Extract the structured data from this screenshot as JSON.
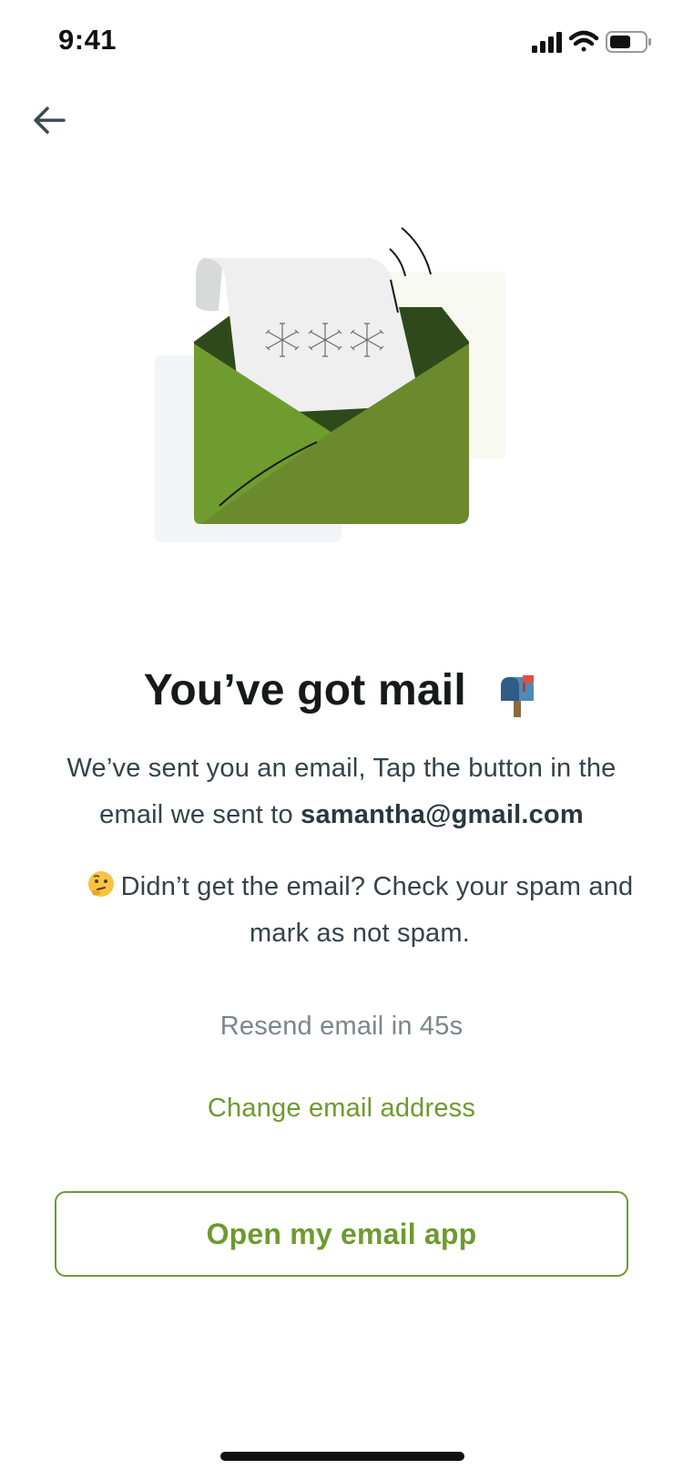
{
  "status_bar": {
    "time": "9:41",
    "icons": [
      "signal-icon",
      "wifi-icon",
      "battery-icon"
    ]
  },
  "nav": {
    "back_icon": "arrow-left-icon"
  },
  "illustration": {
    "name": "open-envelope-illustration",
    "password_mask": "***",
    "colors": {
      "envelope_front": "#6b8a2d",
      "envelope_left": "#6f9c2f",
      "envelope_inner": "#2e4a1a",
      "letter": "#eeeeee",
      "back_panel_left": "#f3f4f5",
      "back_panel_right": "#f8faf1"
    }
  },
  "main": {
    "title": "You’ve got mail",
    "title_emoji": "mailbox-with-raised-flag-icon",
    "description_prefix": "We’ve sent you an email, Tap the button in the email we sent to ",
    "email": "samantha@gmail.com",
    "spam_emoji": "thinking-face-icon",
    "spam_hint": "Didn’t get the email? Check your spam and mark as not spam.",
    "resend_label": "Resend email in 45s",
    "change_email_label": "Change email address",
    "open_mail_button_label": "Open my email app"
  },
  "colors": {
    "accent": "#6d9a2e",
    "title": "#161a1b",
    "body_text": "#34434a",
    "muted_text": "#7a868c"
  }
}
